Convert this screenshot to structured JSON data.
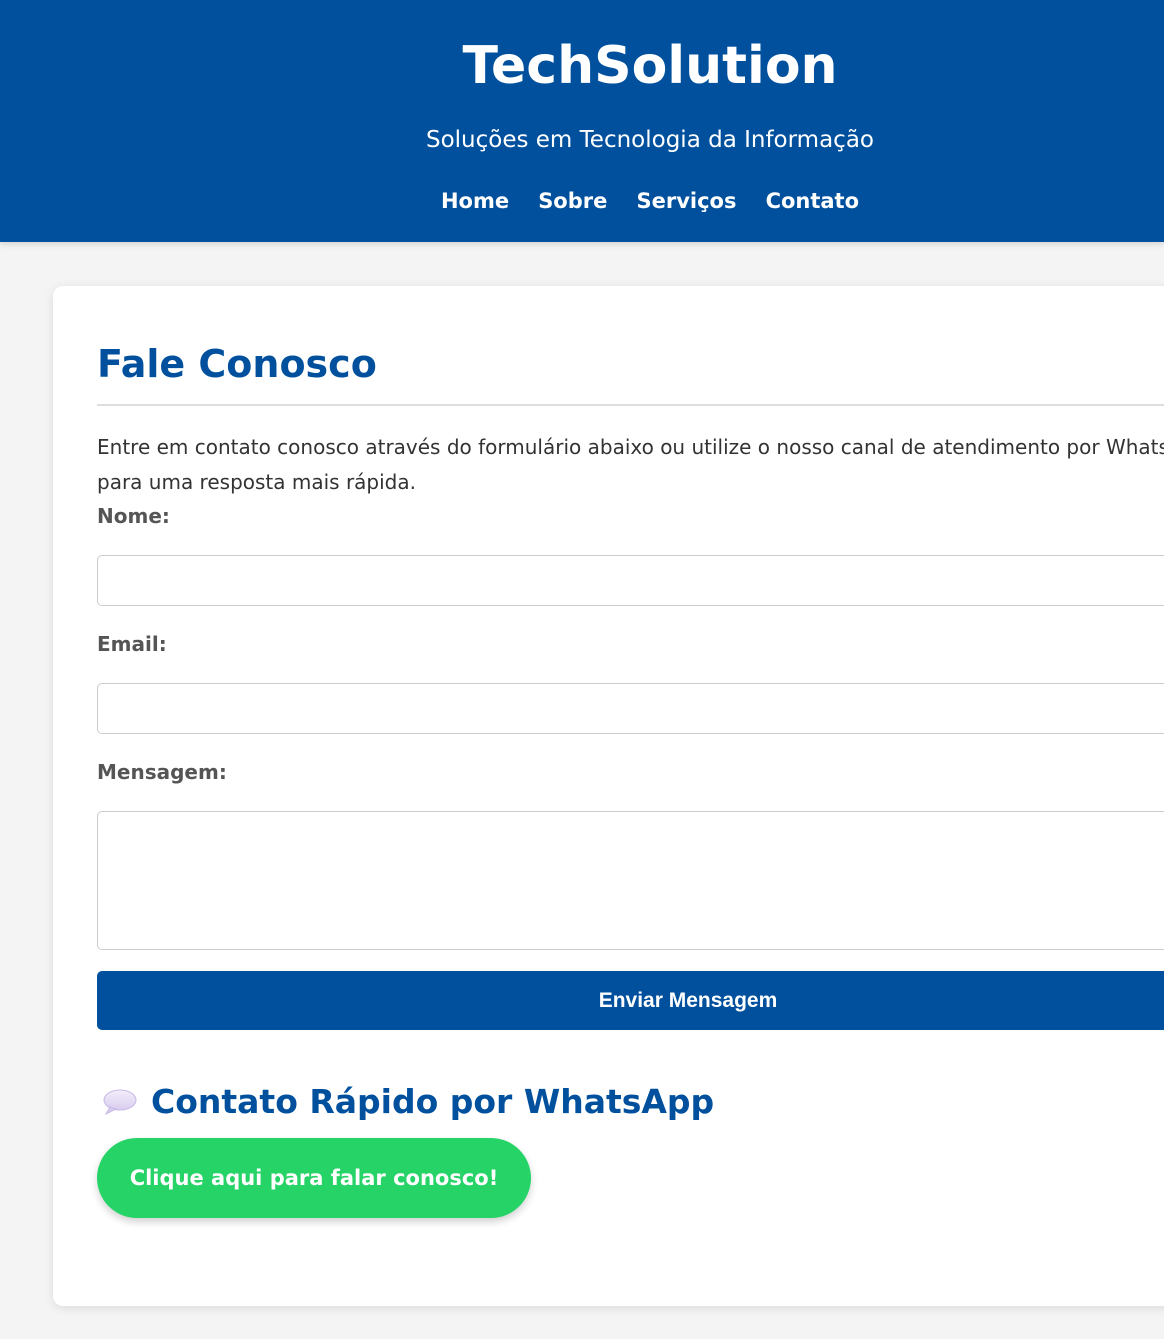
{
  "header": {
    "brand": "TechSolution",
    "tagline": "Soluções em Tecnologia da Informação",
    "nav": [
      "Home",
      "Sobre",
      "Serviços",
      "Contato"
    ]
  },
  "contact": {
    "title": "Fale Conosco",
    "intro_line1": "Entre em contato conosco através do formulário abaixo ou utilize o nosso canal de atendimento por WhatsApp",
    "intro_line2": "para uma resposta mais rápida.",
    "name_label": "Nome:",
    "name_value": "",
    "email_label": "Email:",
    "email_value": "",
    "message_label": "Mensagem:",
    "message_value": "",
    "submit_label": "Enviar Mensagem"
  },
  "whatsapp": {
    "icon": "speech-bubble-icon",
    "title": "Contato Rápido por WhatsApp",
    "button_label": "Clique aqui para falar conosco!"
  },
  "colors": {
    "primary": "#00509d",
    "whatsapp": "#25d366",
    "background": "#f4f4f4"
  }
}
